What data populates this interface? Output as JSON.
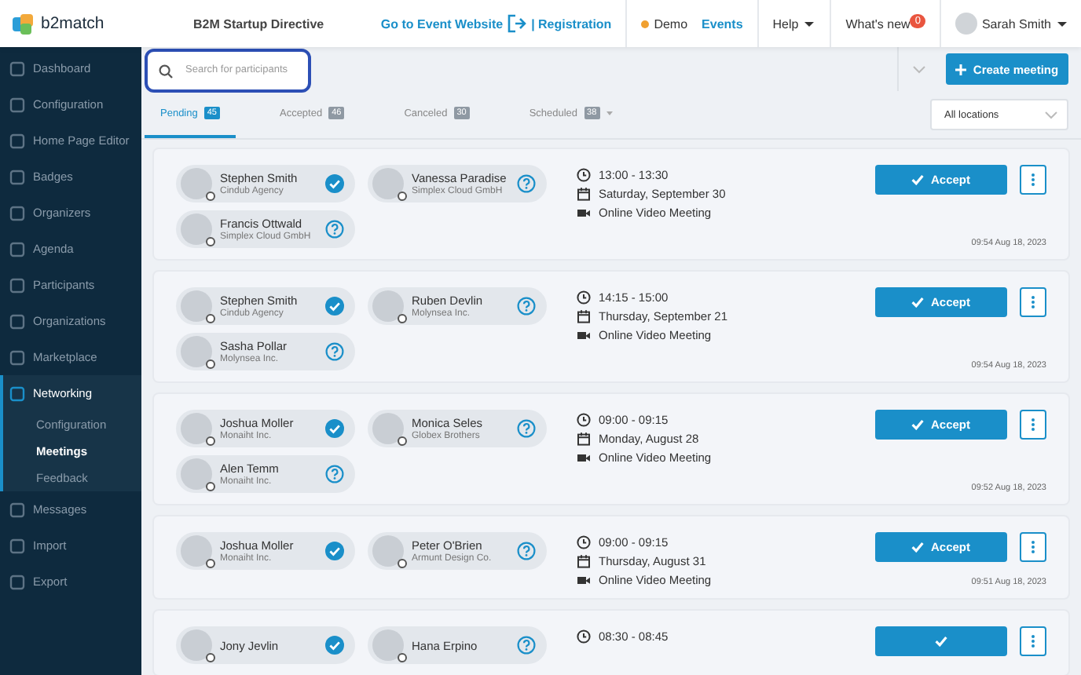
{
  "header": {
    "logo": "b2match",
    "event_title": "B2M Startup Directive",
    "event_website_link": "Go to Event Website",
    "registration_link": "| Registration",
    "demo_label": "Demo",
    "events_link": "Events",
    "help_menu": "Help",
    "whats_new": "What's new",
    "whats_new_count": "0",
    "user_name": "Sarah Smith"
  },
  "sidebar": {
    "items": [
      {
        "label": "Dashboard",
        "selected": false,
        "expanded": false
      },
      {
        "label": "Configuration",
        "selected": false,
        "expanded": false
      },
      {
        "label": "Home Page Editor",
        "selected": false,
        "expanded": false
      },
      {
        "label": "Badges",
        "selected": false,
        "expanded": false
      },
      {
        "label": "Organizers",
        "selected": false,
        "expanded": false
      },
      {
        "label": "Agenda",
        "selected": false,
        "expanded": false
      },
      {
        "label": "Participants",
        "selected": false,
        "expanded": false
      },
      {
        "label": "Organizations",
        "selected": false,
        "expanded": false
      },
      {
        "label": "Marketplace",
        "selected": false,
        "expanded": false
      },
      {
        "label": "Networking",
        "selected": true,
        "expanded": true,
        "children": [
          {
            "label": "Configuration",
            "selected": false
          },
          {
            "label": "Meetings",
            "selected": true
          },
          {
            "label": "Feedback",
            "selected": false
          }
        ]
      },
      {
        "label": "Messages",
        "selected": false,
        "expanded": false
      },
      {
        "label": "Import",
        "selected": false,
        "expanded": false
      },
      {
        "label": "Export",
        "selected": false,
        "expanded": false
      }
    ]
  },
  "toolbar": {
    "search": {
      "placeholder": "Search for participants",
      "focused": true
    },
    "create_button": "Create meeting"
  },
  "tabs": [
    {
      "label": "Pending",
      "count": "45",
      "selected": true,
      "has_menu": false
    },
    {
      "label": "Accepted",
      "count": "46",
      "selected": false,
      "has_menu": false
    },
    {
      "label": "Canceled",
      "count": "30",
      "selected": false,
      "has_menu": false
    },
    {
      "label": "Scheduled",
      "count": "38",
      "selected": false,
      "has_menu": true
    }
  ],
  "location_filter": "All locations",
  "meetings": [
    {
      "participants": [
        {
          "name": "Stephen Smith",
          "company": "Cindub Agency",
          "accepted": true
        },
        {
          "name": "Vanessa Paradise",
          "company": "Simplex Cloud GmbH",
          "accepted": false
        },
        {
          "name": "Francis Ottwald",
          "company": "Simplex Cloud GmbH",
          "accepted": false
        }
      ],
      "time": "13:00 - 13:30",
      "date": "Saturday, September 30",
      "location": "Online Video Meeting",
      "accept_button": "Accept",
      "created": "09:54 Aug 18, 2023"
    },
    {
      "participants": [
        {
          "name": "Stephen Smith",
          "company": "Cindub Agency",
          "accepted": true
        },
        {
          "name": "Ruben Devlin",
          "company": "Molynsea Inc.",
          "accepted": false
        },
        {
          "name": "Sasha Pollar",
          "company": "Molynsea Inc.",
          "accepted": false
        }
      ],
      "time": "14:15 - 15:00",
      "date": "Thursday, September 21",
      "location": "Online Video Meeting",
      "accept_button": "Accept",
      "created": "09:54 Aug 18, 2023"
    },
    {
      "participants": [
        {
          "name": "Joshua Moller",
          "company": "Monaiht Inc.",
          "accepted": true
        },
        {
          "name": "Monica Seles",
          "company": "Globex Brothers",
          "accepted": false
        },
        {
          "name": "Alen Temm",
          "company": "Monaiht Inc.",
          "accepted": false
        }
      ],
      "time": "09:00 - 09:15",
      "date": "Monday, August 28",
      "location": "Online Video Meeting",
      "accept_button": "Accept",
      "created": "09:52 Aug 18, 2023"
    },
    {
      "participants": [
        {
          "name": "Joshua Moller",
          "company": "Monaiht Inc.",
          "accepted": true
        },
        {
          "name": "Peter O'Brien",
          "company": "Armunt Design Co.",
          "accepted": false
        }
      ],
      "time": "09:00 - 09:15",
      "date": "Thursday, August 31",
      "location": "Online Video Meeting",
      "accept_button": "Accept",
      "created": "09:51 Aug 18, 2023"
    },
    {
      "participants": [
        {
          "name": "Jony Jevlin",
          "accepted": true
        },
        {
          "name": "Hana Erpino",
          "accepted": false
        }
      ],
      "time": "08:30 - 08:45"
    }
  ]
}
